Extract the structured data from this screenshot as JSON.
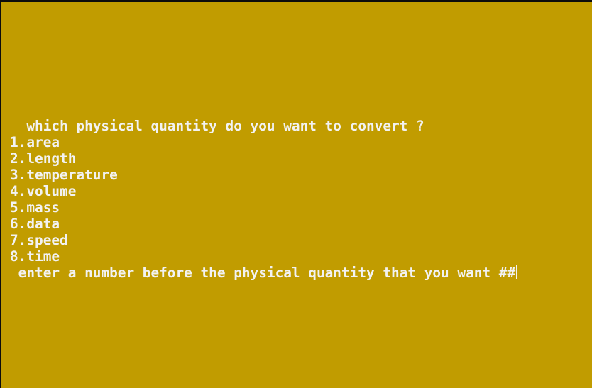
{
  "console": {
    "background_color": "#c19c00",
    "text_color": "#f2f2f2",
    "question": "  which physical quantity do you want to convert ?",
    "options": [
      "1.area",
      "2.length",
      "3.temperature",
      "4.volume",
      "5.mass",
      "6.data",
      "7.speed",
      "8.time"
    ],
    "prompt": " enter a number before the physical quantity that you want ##"
  }
}
